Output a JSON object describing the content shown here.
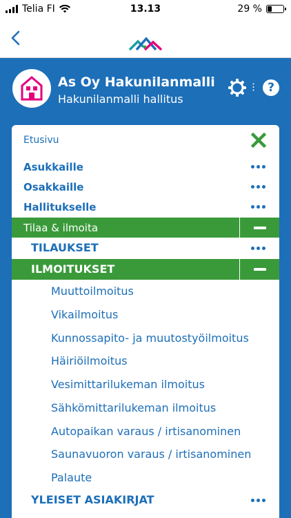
{
  "status_bar": {
    "carrier": "Telia FI",
    "time": "13.13",
    "battery_percent": "29 %",
    "battery_level": 0.29
  },
  "header": {
    "title": "As Oy Hakunilanmalli",
    "subtitle": "Hakunilanmalli hallitus",
    "help_label": "?"
  },
  "menu": {
    "home_label": "Etusivu",
    "items": [
      {
        "label": "Asukkaille"
      },
      {
        "label": "Osakkaille"
      },
      {
        "label": "Hallitukselle"
      }
    ],
    "expanded_section": "Tilaa & ilmoita",
    "orders_label": "TILAUKSET",
    "notices_label": "ILMOITUKSET",
    "notices": [
      "Muuttoilmoitus",
      "Vikailmoitus",
      "Kunnossapito- ja muutostyöilmoitus",
      "Häiriöilmoitus",
      "Vesimittarilukeman ilmoitus",
      "Sähkömittarilukeman ilmoitus",
      "Autopaikan varaus / irtisanominen",
      "Saunavuoron varaus / irtisanominen",
      "Palaute"
    ],
    "documents_label": "YLEISET ASIAKIRJAT"
  },
  "colors": {
    "brand_blue": "#1d6fb8",
    "active_green": "#3a9a3a",
    "close_green": "#3a9a3a",
    "house_pink": "#e5007d"
  }
}
